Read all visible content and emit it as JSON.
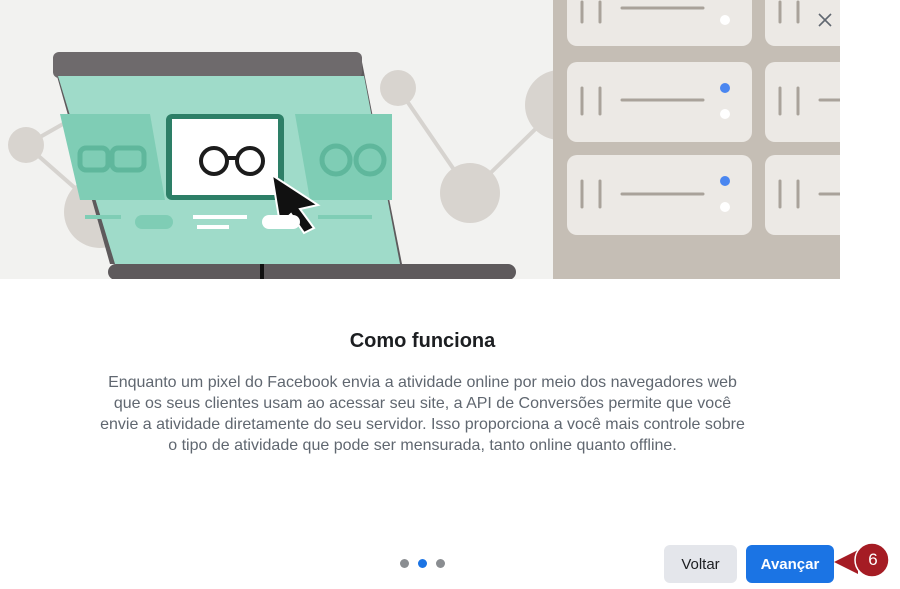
{
  "dialog": {
    "close_icon": "close-icon",
    "title": "Como funciona",
    "description": "Enquanto um pixel do Facebook envia a atividade online por meio dos navegadores web que os seus clientes usam ao acessar seu site, a API de Conversões permite que você envie a atividade diretamente do seu servidor. Isso proporciona a você mais controle sobre o tipo de atividade que pode ser mensurada, tanto online quanto offline.",
    "pagination": {
      "total": 3,
      "current": 2
    },
    "back_label": "Voltar",
    "next_label": "Avançar"
  },
  "annotation": {
    "step_number": "6"
  },
  "colors": {
    "primary": "#1b74e4",
    "secondary_button": "#e4e6eb",
    "badge": "#a51c24",
    "screen_green": "#9fdbc9",
    "server_gray": "#c5beb5"
  }
}
